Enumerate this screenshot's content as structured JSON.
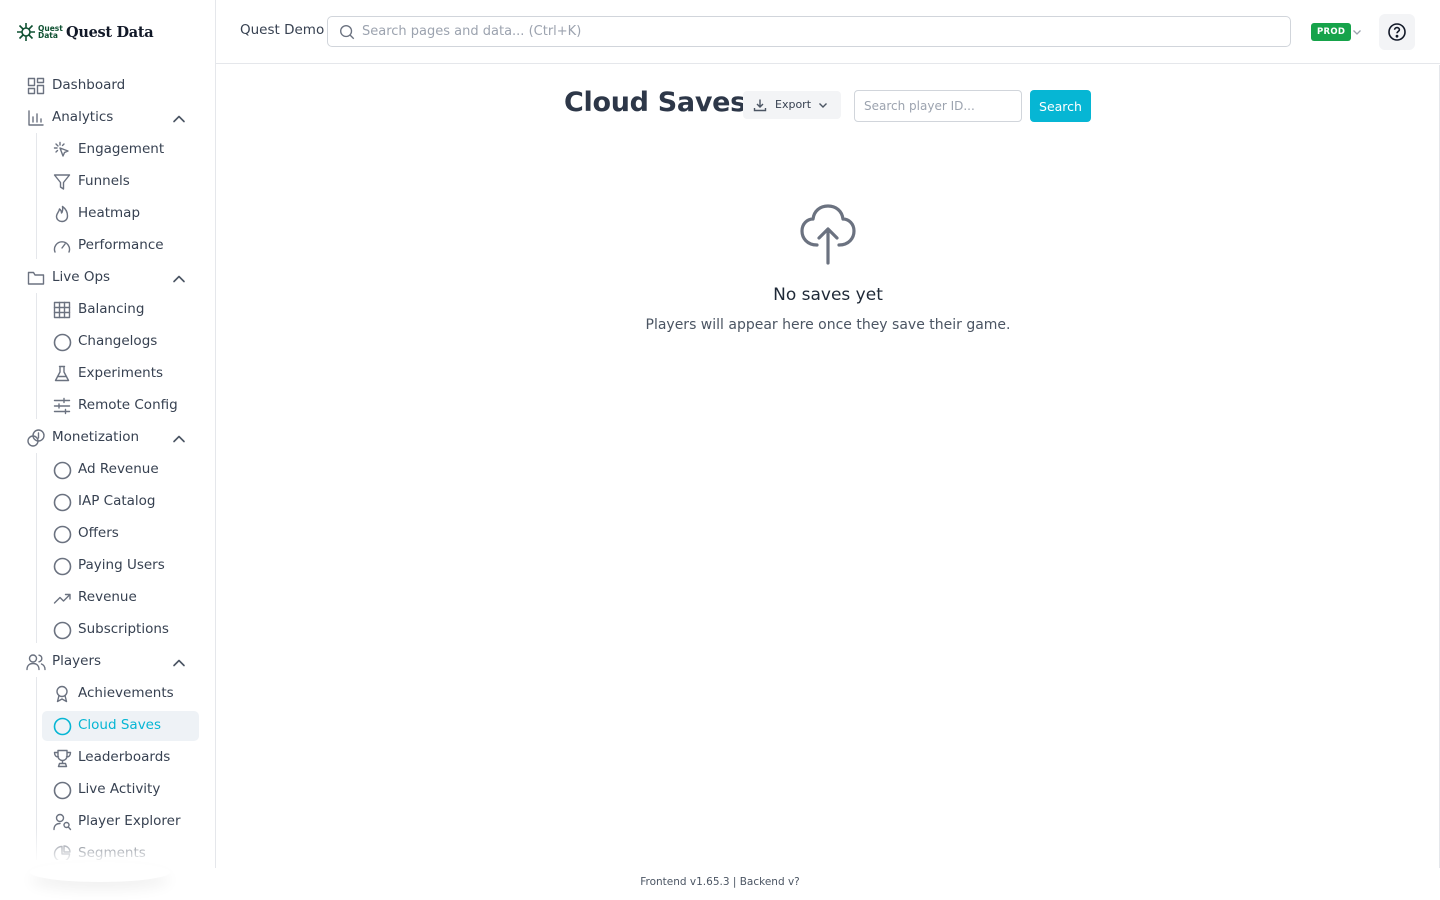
{
  "brand": {
    "mini_line1": "Quest",
    "mini_line2": "Data",
    "name": "Quest Data",
    "color": "#0f5132"
  },
  "topbar": {
    "workspace": "Quest Demo",
    "search_placeholder": "Search pages and data... (Ctrl+K)",
    "env_badge": "PROD",
    "env_color": "#16a34a"
  },
  "sidebar": {
    "items": [
      {
        "label": "Dashboard",
        "icon": "dashboard-icon",
        "level": "top"
      },
      {
        "label": "Analytics",
        "icon": "bar-chart-icon",
        "level": "top",
        "expanded": true
      },
      {
        "label": "Engagement",
        "icon": "pointer-click-icon",
        "level": "sub"
      },
      {
        "label": "Funnels",
        "icon": "funnel-icon",
        "level": "sub"
      },
      {
        "label": "Heatmap",
        "icon": "flame-icon",
        "level": "sub"
      },
      {
        "label": "Performance",
        "icon": "gauge-icon",
        "level": "sub"
      },
      {
        "label": "Live Ops",
        "icon": "folder-icon",
        "level": "top",
        "expanded": true
      },
      {
        "label": "Balancing",
        "icon": "grid-icon",
        "level": "sub"
      },
      {
        "label": "Changelogs",
        "icon": "circle-icon",
        "level": "sub"
      },
      {
        "label": "Experiments",
        "icon": "flask-icon",
        "level": "sub"
      },
      {
        "label": "Remote Config",
        "icon": "sliders-icon",
        "level": "sub"
      },
      {
        "label": "Monetization",
        "icon": "coins-icon",
        "level": "top",
        "expanded": true
      },
      {
        "label": "Ad Revenue",
        "icon": "circle-icon",
        "level": "sub"
      },
      {
        "label": "IAP Catalog",
        "icon": "circle-icon",
        "level": "sub"
      },
      {
        "label": "Offers",
        "icon": "circle-icon",
        "level": "sub"
      },
      {
        "label": "Paying Users",
        "icon": "circle-icon",
        "level": "sub"
      },
      {
        "label": "Revenue",
        "icon": "trend-up-icon",
        "level": "sub"
      },
      {
        "label": "Subscriptions",
        "icon": "circle-icon",
        "level": "sub"
      },
      {
        "label": "Players",
        "icon": "users-icon",
        "level": "top",
        "expanded": true
      },
      {
        "label": "Achievements",
        "icon": "award-icon",
        "level": "sub"
      },
      {
        "label": "Cloud Saves",
        "icon": "circle-icon",
        "level": "sub",
        "active": true
      },
      {
        "label": "Leaderboards",
        "icon": "trophy-icon",
        "level": "sub"
      },
      {
        "label": "Live Activity",
        "icon": "circle-icon",
        "level": "sub"
      },
      {
        "label": "Player Explorer",
        "icon": "user-search-icon",
        "level": "sub"
      },
      {
        "label": "Segments",
        "icon": "pie-icon",
        "level": "sub"
      }
    ],
    "active_color": "#06b6d4"
  },
  "main": {
    "title": "Cloud Saves",
    "export_label": "Export",
    "player_search_placeholder": "Search player ID...",
    "search_button": "Search",
    "empty_title": "No saves yet",
    "empty_subtitle": "Players will appear here once they save their game."
  },
  "footer": {
    "text": "Frontend v1.65.3 | Backend v?"
  }
}
